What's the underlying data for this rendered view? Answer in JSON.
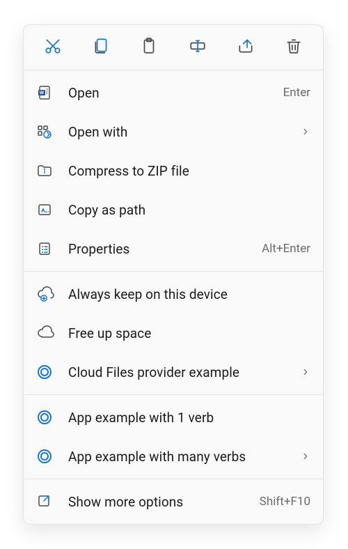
{
  "toolbar": {
    "actions": [
      {
        "name": "cut",
        "accent": true
      },
      {
        "name": "copy",
        "accent": true
      },
      {
        "name": "paste",
        "accent": false
      },
      {
        "name": "rename",
        "accent": true
      },
      {
        "name": "share",
        "accent": true
      },
      {
        "name": "delete",
        "accent": false
      }
    ]
  },
  "sections": [
    {
      "items": [
        {
          "icon": "word-doc",
          "label": "Open",
          "shortcut": "Enter",
          "submenu": false
        },
        {
          "icon": "open-with",
          "label": "Open with",
          "shortcut": "",
          "submenu": true
        },
        {
          "icon": "zip",
          "label": "Compress to ZIP file",
          "shortcut": "",
          "submenu": false
        },
        {
          "icon": "copy-path",
          "label": "Copy as path",
          "shortcut": "",
          "submenu": false
        },
        {
          "icon": "properties",
          "label": "Properties",
          "shortcut": "Alt+Enter",
          "submenu": false
        }
      ]
    },
    {
      "items": [
        {
          "icon": "cloud-keep",
          "label": "Always keep on this device",
          "shortcut": "",
          "submenu": false
        },
        {
          "icon": "cloud-free",
          "label": "Free up space",
          "shortcut": "",
          "submenu": false
        },
        {
          "icon": "cloud-app",
          "label": "Cloud Files provider example",
          "shortcut": "",
          "submenu": true
        }
      ]
    },
    {
      "items": [
        {
          "icon": "cloud-app",
          "label": "App example with 1 verb",
          "shortcut": "",
          "submenu": false
        },
        {
          "icon": "cloud-app",
          "label": "App example with many verbs",
          "shortcut": "",
          "submenu": true
        }
      ]
    },
    {
      "items": [
        {
          "icon": "show-more",
          "label": "Show more options",
          "shortcut": "Shift+F10",
          "submenu": false
        }
      ]
    }
  ],
  "colors": {
    "accent": "#1977d3",
    "muted": "#4b4b4b"
  }
}
